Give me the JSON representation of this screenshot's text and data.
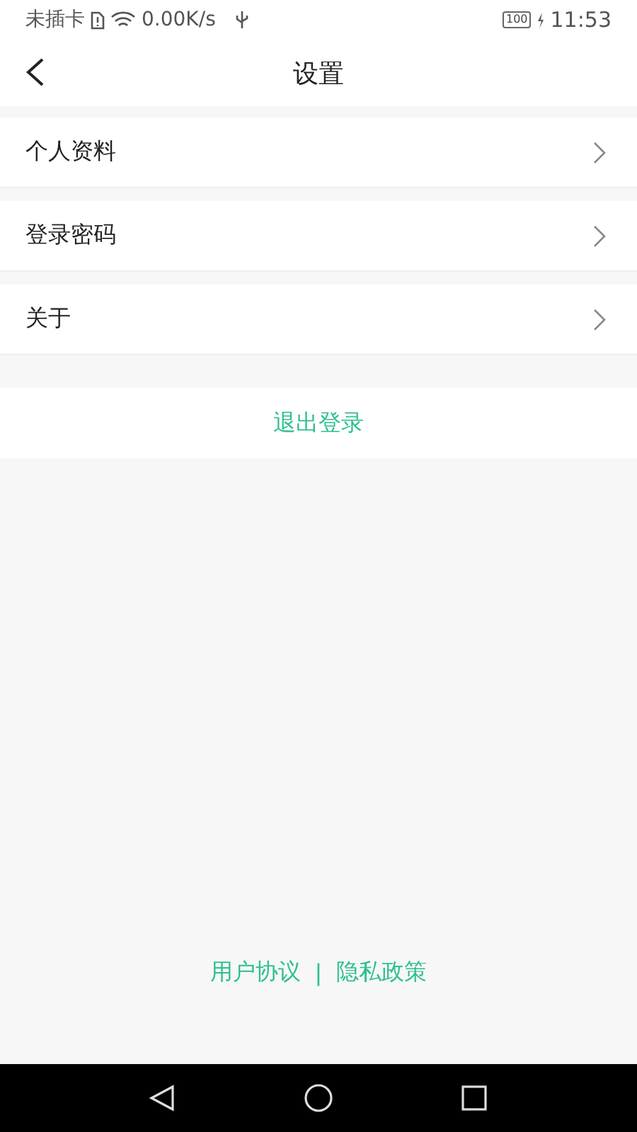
{
  "status_bar": {
    "carrier": "未插卡",
    "speed": "0.00K/s",
    "battery": "100",
    "time": "11:53"
  },
  "header": {
    "title": "设置"
  },
  "items": [
    {
      "label": "个人资料"
    },
    {
      "label": "登录密码"
    },
    {
      "label": "关于"
    }
  ],
  "logout": {
    "label": "退出登录"
  },
  "footer": {
    "links": [
      "用户协议",
      "隐私政策"
    ],
    "separator": "|"
  }
}
